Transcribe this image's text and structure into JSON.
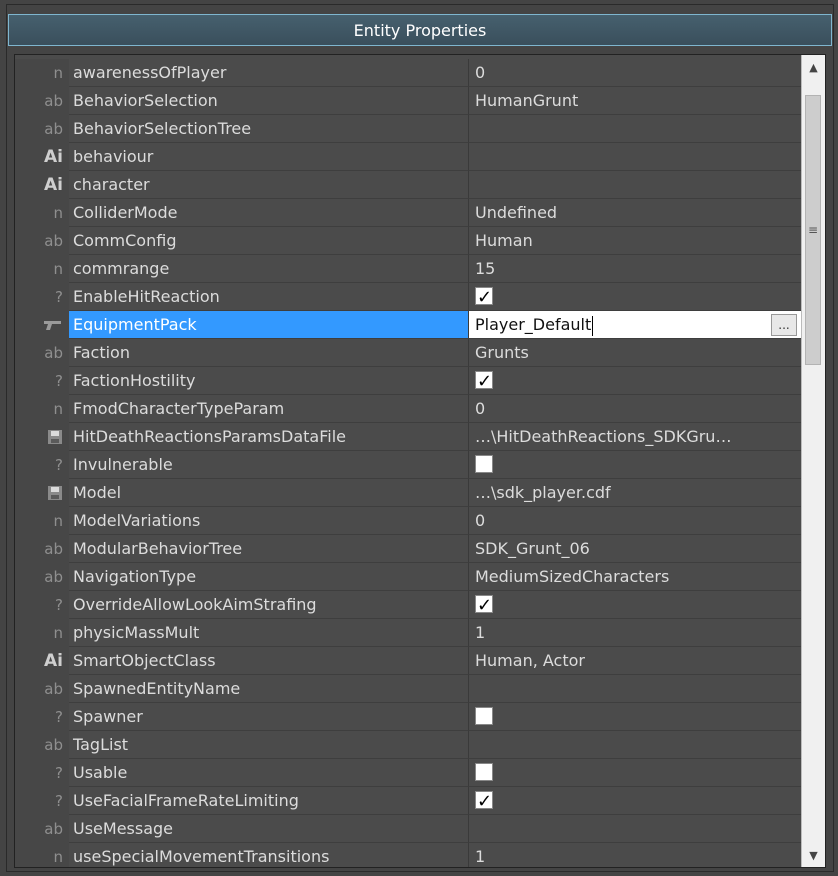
{
  "window": {
    "title": "Entity Properties"
  },
  "properties": [
    {
      "icon": "n",
      "name": "awarenessOfPlayer",
      "value": "0"
    },
    {
      "icon": "ab",
      "name": "BehaviorSelection",
      "value": "HumanGrunt"
    },
    {
      "icon": "ab",
      "name": "BehaviorSelectionTree",
      "value": ""
    },
    {
      "icon": "Ai",
      "name": "behaviour",
      "value": ""
    },
    {
      "icon": "Ai",
      "name": "character",
      "value": ""
    },
    {
      "icon": "n",
      "name": "ColliderMode",
      "value": "Undefined"
    },
    {
      "icon": "ab",
      "name": "CommConfig",
      "value": "Human"
    },
    {
      "icon": "n",
      "name": "commrange",
      "value": "15"
    },
    {
      "icon": "?",
      "name": "EnableHitReaction",
      "value": "",
      "checkbox": true,
      "checked": true
    },
    {
      "icon": "gun",
      "name": "EquipmentPack",
      "value": "Player_Default",
      "selected": true,
      "button": "..."
    },
    {
      "icon": "ab",
      "name": "Faction",
      "value": "Grunts"
    },
    {
      "icon": "?",
      "name": "FactionHostility",
      "value": "",
      "checkbox": true,
      "checked": true
    },
    {
      "icon": "n",
      "name": "FmodCharacterTypeParam",
      "value": "0"
    },
    {
      "icon": "file",
      "name": "HitDeathReactionsParamsDataFile",
      "value": "…\\HitDeathReactions_SDKGru…"
    },
    {
      "icon": "?",
      "name": "Invulnerable",
      "value": "",
      "checkbox": true,
      "checked": false
    },
    {
      "icon": "file",
      "name": "Model",
      "value": "…\\sdk_player.cdf"
    },
    {
      "icon": "n",
      "name": "ModelVariations",
      "value": "0"
    },
    {
      "icon": "ab",
      "name": "ModularBehaviorTree",
      "value": "SDK_Grunt_06"
    },
    {
      "icon": "ab",
      "name": "NavigationType",
      "value": "MediumSizedCharacters"
    },
    {
      "icon": "?",
      "name": "OverrideAllowLookAimStrafing",
      "value": "",
      "checkbox": true,
      "checked": true
    },
    {
      "icon": "n",
      "name": "physicMassMult",
      "value": "1"
    },
    {
      "icon": "Ai",
      "name": "SmartObjectClass",
      "value": "Human, Actor"
    },
    {
      "icon": "ab",
      "name": "SpawnedEntityName",
      "value": ""
    },
    {
      "icon": "?",
      "name": "Spawner",
      "value": "",
      "checkbox": true,
      "checked": false
    },
    {
      "icon": "ab",
      "name": "TagList",
      "value": ""
    },
    {
      "icon": "?",
      "name": "Usable",
      "value": "",
      "checkbox": true,
      "checked": false
    },
    {
      "icon": "?",
      "name": "UseFacialFrameRateLimiting",
      "value": "",
      "checkbox": true,
      "checked": true
    },
    {
      "icon": "ab",
      "name": "UseMessage",
      "value": ""
    },
    {
      "icon": "n",
      "name": "useSpecialMovementTransitions",
      "value": "1"
    }
  ],
  "colors": {
    "selection": "#3399ff",
    "titlebar_border": "#7fb6cf",
    "background": "#444444"
  }
}
